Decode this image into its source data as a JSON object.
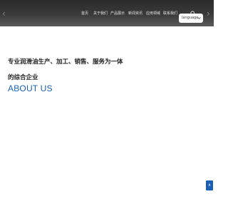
{
  "nav": {
    "items": [
      {
        "label": "首页"
      },
      {
        "label": "关于我们"
      },
      {
        "label": "产品展示"
      },
      {
        "label": "新闻资讯"
      },
      {
        "label": "应用领域"
      },
      {
        "label": "联系我们"
      }
    ],
    "search_icon": "search-icon",
    "language_select": {
      "value": "language",
      "icon": "chevron-down-icon"
    }
  },
  "hero": {
    "prev_arrow": "‹",
    "next_arrow": "›"
  },
  "about": {
    "headline_line1": "专业润滑油生产、加工、销售、服务为一体",
    "headline_line2": "的综合企业",
    "title": "ABOUT US"
  },
  "back_to_top": {
    "label": "∧"
  },
  "colors": {
    "accent": "#1a5fb4",
    "header_bg": "#333333"
  }
}
